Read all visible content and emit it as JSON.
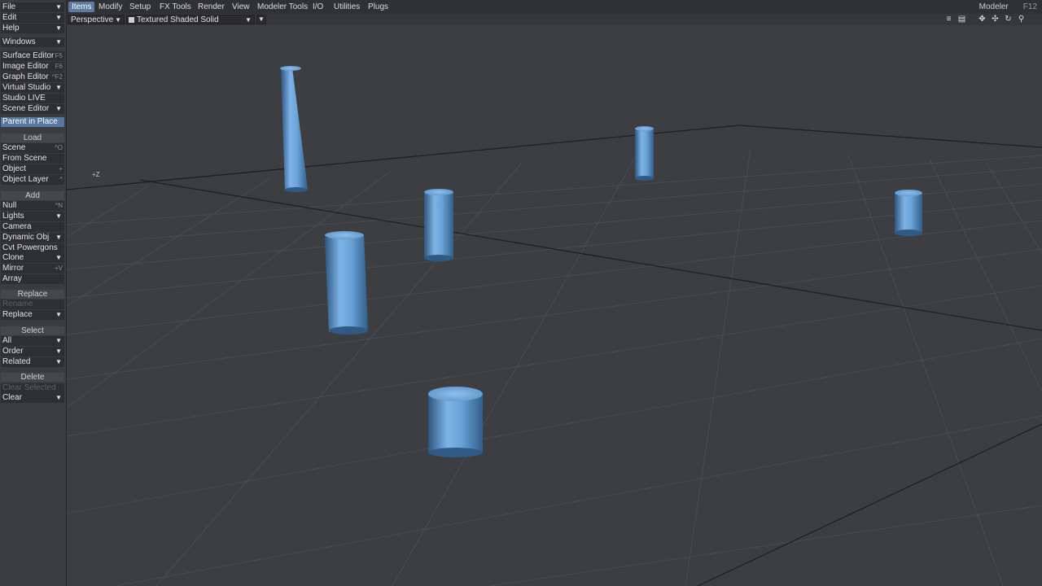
{
  "left_panel": {
    "top_menus": [
      {
        "label": "File"
      },
      {
        "label": "Edit"
      },
      {
        "label": "Help"
      }
    ],
    "windows": {
      "label": "Windows"
    },
    "editors": [
      {
        "label": "Surface Editor",
        "shortcut": "F5"
      },
      {
        "label": "Image Editor",
        "shortcut": "F6"
      },
      {
        "label": "Graph Editor",
        "shortcut": "^F2"
      },
      {
        "label": "Virtual Studio",
        "shortcut": ""
      },
      {
        "label": "Studio LIVE",
        "shortcut": ""
      },
      {
        "label": "Scene Editor",
        "shortcut": ""
      }
    ],
    "parent_in_place": "Parent in Place",
    "load": {
      "header": "Load",
      "items": [
        {
          "label": "Scene",
          "shortcut": "^O"
        },
        {
          "label": "From Scene",
          "shortcut": ""
        },
        {
          "label": "Object",
          "shortcut": "+"
        },
        {
          "label": "Object Layer",
          "shortcut": "^"
        }
      ]
    },
    "add": {
      "header": "Add",
      "items": [
        {
          "label": "Null",
          "shortcut": "^N"
        },
        {
          "label": "Lights",
          "shortcut": ""
        },
        {
          "label": "Camera",
          "shortcut": ""
        },
        {
          "label": "Dynamic Obj",
          "shortcut": ""
        },
        {
          "label": "Cvt Powergons",
          "shortcut": ""
        },
        {
          "label": "Clone",
          "shortcut": ""
        },
        {
          "label": "Mirror",
          "shortcut": "+V"
        },
        {
          "label": "Array",
          "shortcut": ""
        }
      ]
    },
    "replace": {
      "header": "Replace",
      "rename": "Rename",
      "replace": "Replace"
    },
    "select": {
      "header": "Select",
      "items": [
        {
          "label": "All"
        },
        {
          "label": "Order"
        },
        {
          "label": "Related"
        }
      ]
    },
    "delete": {
      "header": "Delete",
      "clear_selected": "Clear Selected",
      "clear": "Clear"
    }
  },
  "tabs": [
    "Items",
    "Modify",
    "Setup",
    "FX Tools",
    "Render",
    "View",
    "Modeler Tools",
    "I/O",
    "Utilities",
    "Plugs"
  ],
  "active_tab": "Items",
  "modeler": {
    "label": "Modeler",
    "shortcut": "F12"
  },
  "viewport": {
    "view_mode": "Perspective",
    "render_mode": "Textured Shaded Solid",
    "axis_label": "+Z",
    "object_color": "#6aa4d8"
  },
  "header_icons": [
    "list-icon",
    "layout-icon",
    "move-icon",
    "pan-icon",
    "rotate-icon",
    "zoom-icon"
  ]
}
